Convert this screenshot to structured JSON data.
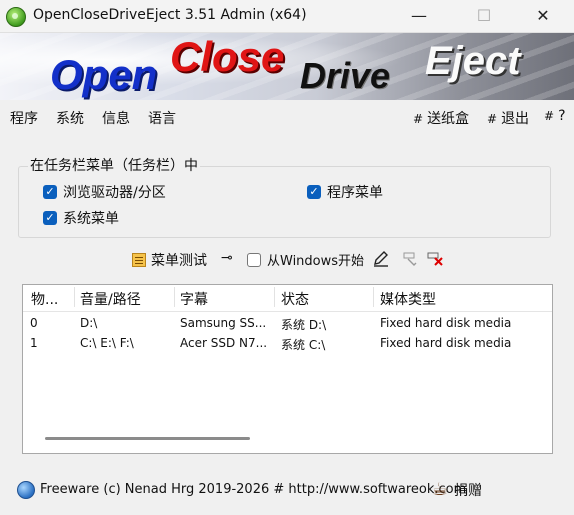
{
  "window": {
    "title": "OpenCloseDriveEject 3.51 Admin (x64)",
    "minimize_glyph": "—",
    "maximize_glyph": "☐",
    "close_glyph": "✕"
  },
  "banner": {
    "open": "Open",
    "close": "Close",
    "drive": "Drive",
    "eject": "Eject"
  },
  "menubar": {
    "items": [
      "程序",
      "系统",
      "信息",
      "语言"
    ],
    "right": [
      {
        "hash": "#",
        "label": "送纸盒"
      },
      {
        "hash": "#",
        "label": "退出"
      },
      {
        "hash": "#",
        "label": "?"
      }
    ]
  },
  "group": {
    "title": "在任务栏菜单（任务栏）中",
    "options": [
      {
        "label": "浏览驱动器/分区",
        "checked": true
      },
      {
        "label": "程序菜单",
        "checked": true
      },
      {
        "label": "系统菜单",
        "checked": true
      }
    ]
  },
  "toolbar": {
    "menu_test": "菜单测试",
    "start_with_windows": "从Windows开始",
    "start_with_windows_checked": false
  },
  "list": {
    "columns": [
      "物...",
      "音量/路径",
      "字幕",
      "状态",
      "媒体类型"
    ],
    "rows": [
      [
        "0",
        "D:\\",
        "Samsung SS...",
        "系统 D:\\",
        "Fixed hard disk media"
      ],
      [
        "1",
        "C:\\ E:\\ F:\\",
        "Acer SSD N7...",
        "系统 C:\\",
        "Fixed hard disk media"
      ]
    ]
  },
  "status": {
    "text": "Freeware (c) Nenad Hrg 2019-2026 # http://www.softwareok.com",
    "donate": "捐赠"
  }
}
